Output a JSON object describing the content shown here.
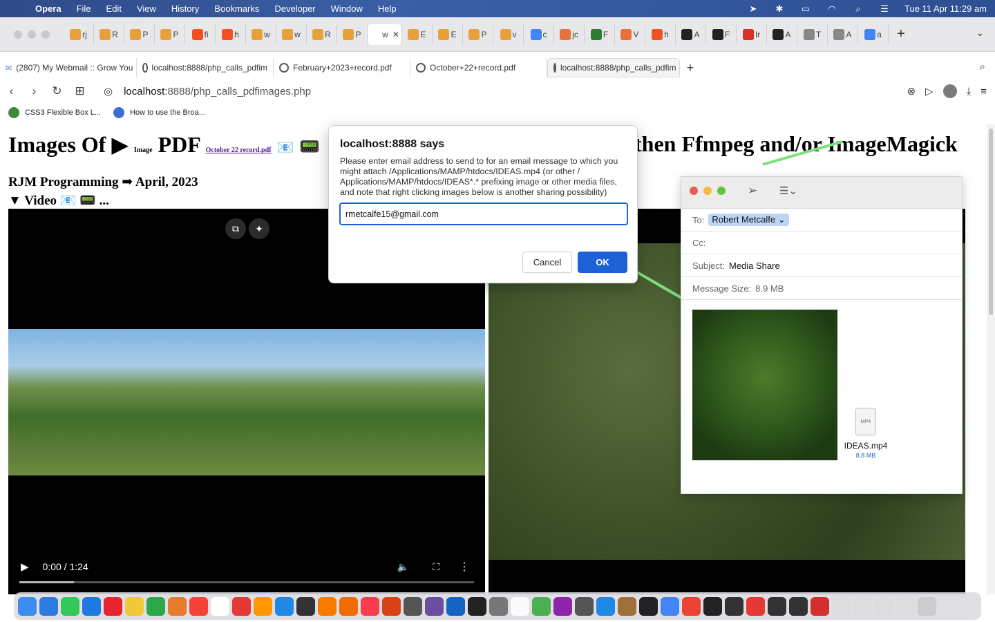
{
  "menubar": {
    "app": "Opera",
    "items": [
      "File",
      "Edit",
      "View",
      "History",
      "Bookmarks",
      "Developer",
      "Window",
      "Help"
    ],
    "clock": "Tue 11 Apr  11:29 am"
  },
  "tabstrip": {
    "pinned_letters": [
      "rj",
      "R",
      "P",
      "P",
      "fi",
      "h",
      "w",
      "w",
      "R",
      "P",
      "w",
      "E",
      "E",
      "P",
      "v",
      "c",
      "jc",
      "F",
      "V",
      "h",
      "A",
      "F",
      "Ir",
      "A",
      "T",
      "A",
      "a"
    ],
    "active_letter": "w",
    "new_tab": "+"
  },
  "tabrow2": {
    "tabs": [
      "(2807) My Webmail :: Grow You",
      "localhost:8888/php_calls_pdfim",
      "February+2023+record.pdf",
      "October+22+record.pdf",
      "localhost:8888/php_calls_pdfim"
    ],
    "new_tab": "+"
  },
  "addressbar": {
    "host": "localhost",
    "path": ":8888/php_calls_pdfimages.php"
  },
  "bookmarks": [
    "CSS3 Flexible Box L...",
    "How to use the Broa..."
  ],
  "page": {
    "title_left": "Images Of ▶",
    "title_small": "Image",
    "title_pdf": "PDF",
    "title_link": "October 22 record.pdf",
    "title_right": "then Ffmpeg and/or ImageMagick",
    "subtitle": "RJM Programming ➡ April, 2023",
    "details": "▼ Video 📧 📟 ...",
    "video_time": "0:00 / 1:24",
    "video_progress": 0.12
  },
  "dialog": {
    "title": "localhost:8888 says",
    "message": "Please enter email address to send to for an email message to which you might attach /Applications/MAMP/htdocs/IDEAS.mp4 (or other / Applications/MAMP/htdocs/IDEAS*.* prefixing image or other media files, and note that right clicking images below is another sharing possibility)",
    "input_value": "rmetcalfe15@gmail.com",
    "cancel": "Cancel",
    "ok": "OK"
  },
  "mail": {
    "to_label": "To:",
    "to_value": "Robert Metcalfe ⌄",
    "cc_label": "Cc:",
    "subject_label": "Subject:",
    "subject_value": "Media Share",
    "size_label": "Message Size:",
    "size_value": "8.9 MB",
    "file_name": "IDEAS.mp4",
    "file_size": "8.8 MB",
    "file_badge": "MP4"
  },
  "colors": {
    "accent": "#1a62d6",
    "menubar": "#3a5fa6",
    "arrow": "#7ee07e"
  }
}
